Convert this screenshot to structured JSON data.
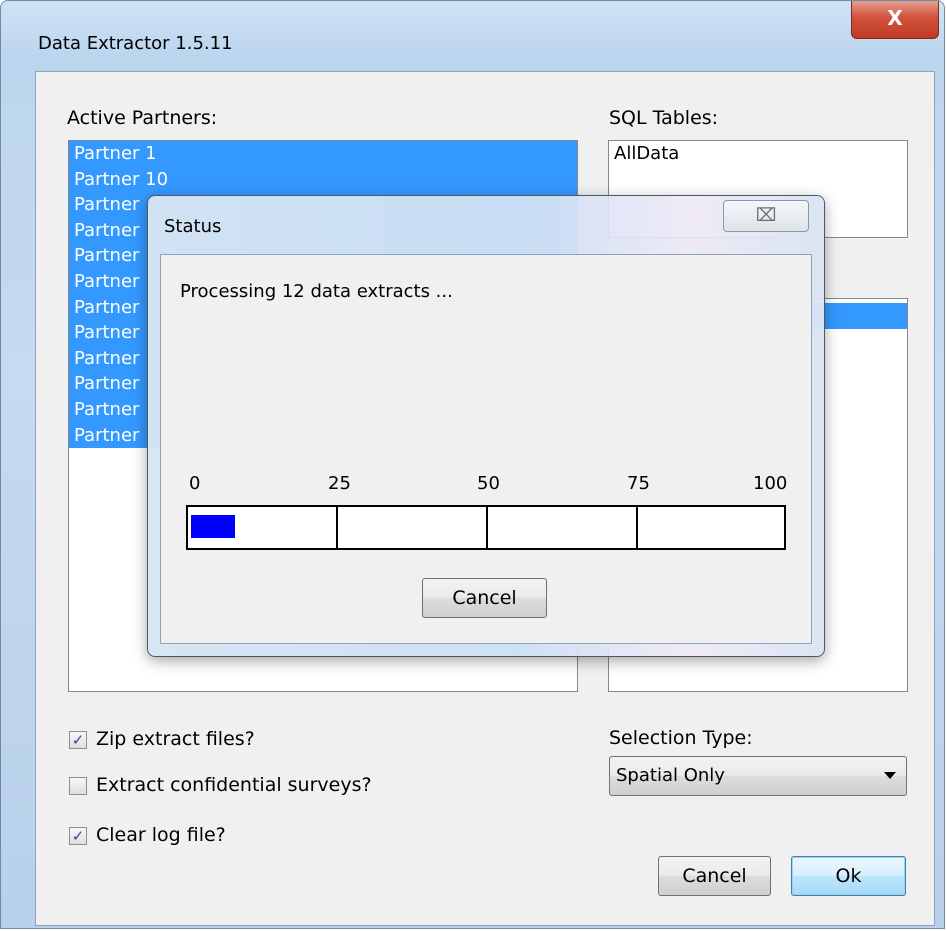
{
  "window": {
    "title": "Data Extractor 1.5.11",
    "close_glyph": "X"
  },
  "active_partners": {
    "label": "Active Partners:",
    "items": [
      "Partner 1",
      "Partner 10",
      "Partner",
      "Partner",
      "Partner",
      "Partner",
      "Partner",
      "Partner",
      "Partner",
      "Partner",
      "Partner",
      "Partner"
    ]
  },
  "sql_tables": {
    "label": "SQL Tables:",
    "items": [
      "AllData"
    ]
  },
  "options": {
    "zip": {
      "label": "Zip extract files?",
      "checked": true
    },
    "confidential": {
      "label": "Extract confidential surveys?",
      "checked": false
    },
    "clear_log": {
      "label": "Clear log file?",
      "checked": true
    }
  },
  "selection_type": {
    "label": "Selection Type:",
    "value": "Spatial Only"
  },
  "buttons": {
    "cancel": "Cancel",
    "ok": "Ok"
  },
  "status_dialog": {
    "title": "Status",
    "message": "Processing 12 data extracts ...",
    "progress_percent": 7.5,
    "ticks": [
      "0",
      "25",
      "50",
      "75",
      "100"
    ],
    "cancel": "Cancel",
    "close_glyph": "⌧"
  },
  "colors": {
    "selection": "#3399ff",
    "progress": "#0000ff"
  }
}
